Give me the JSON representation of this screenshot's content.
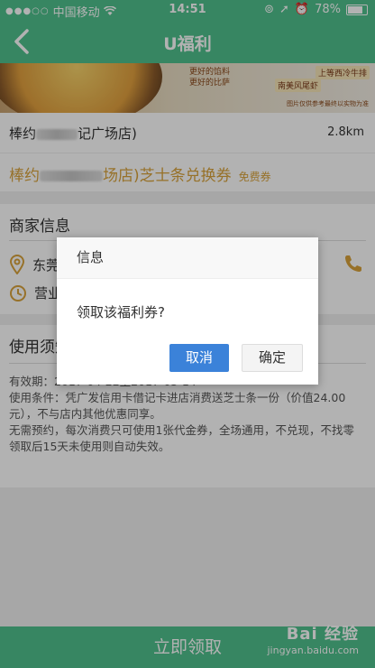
{
  "status_bar": {
    "carrier": "中国移动",
    "time": "14:51",
    "battery": "78%"
  },
  "nav": {
    "title": "U福利"
  },
  "banner": {
    "text_1": "更好的馅料",
    "text_2": "更好的比萨",
    "tag_1": "上等西冷牛排",
    "tag_2": "南美风尾虾",
    "footnote": "图片仅供参考最终以实物为准"
  },
  "shop": {
    "name_prefix": "棒约",
    "name_suffix": "记广场店)",
    "distance": "2.8km"
  },
  "coupon": {
    "name_prefix": "棒约",
    "name_suffix": "场店)芝士条兑换券",
    "badge": "免费券"
  },
  "merchant": {
    "title": "商家信息",
    "address_prefix": "东莞",
    "hours_prefix": "营业"
  },
  "usage": {
    "title": "使用须知",
    "validity": "有效期：2017-04-22至2017-05-14",
    "conditions": "使用条件：凭广发信用卡借记卡进店消费送芝士条一份（价值24.00元），不与店内其他优惠同享。",
    "rules": "无需预约，每次消费只可使用1张代金券，全场通用，不兑现，不找零",
    "expiry": "领取后15天未使用则自动失效。"
  },
  "bottom": {
    "action_label": "立即领取",
    "watermark_brand": "Bai 经验",
    "watermark_url": "jingyan.baidu.com"
  },
  "dialog": {
    "title": "信息",
    "message": "领取该福利券?",
    "cancel_label": "取消",
    "confirm_label": "确定"
  },
  "colors": {
    "primary": "#4fc08d",
    "accent": "#d8a33c",
    "button_blue": "#3b82d9"
  }
}
